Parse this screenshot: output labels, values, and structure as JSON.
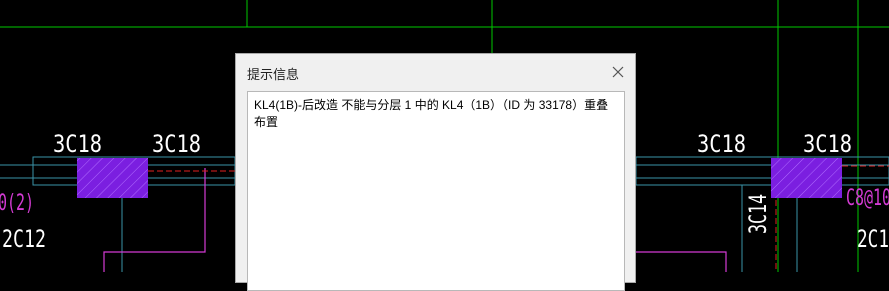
{
  "cad": {
    "rebar_top_left_1": "3C18",
    "rebar_top_left_2": "3C18",
    "rebar_top_right_1": "3C18",
    "rebar_top_right_2": "3C18",
    "rebar_left_partial": "0(2)",
    "rebar_left_bottom": "2C12",
    "rebar_right_vertical": "3C14",
    "rebar_right_magenta": "C8@10",
    "rebar_right_bottom": "2C1"
  },
  "dialog": {
    "title": "提示信息",
    "message": "KL4(1B)-后改造 不能与分层 1 中的 KL4（1B）（ID 为 33178）重叠布置"
  },
  "colors": {
    "beam_fill": "#7b1fe0",
    "grid_green": "#00c800",
    "rebar_magenta": "#d43bd4",
    "outline_cyan": "#3a93a8"
  }
}
